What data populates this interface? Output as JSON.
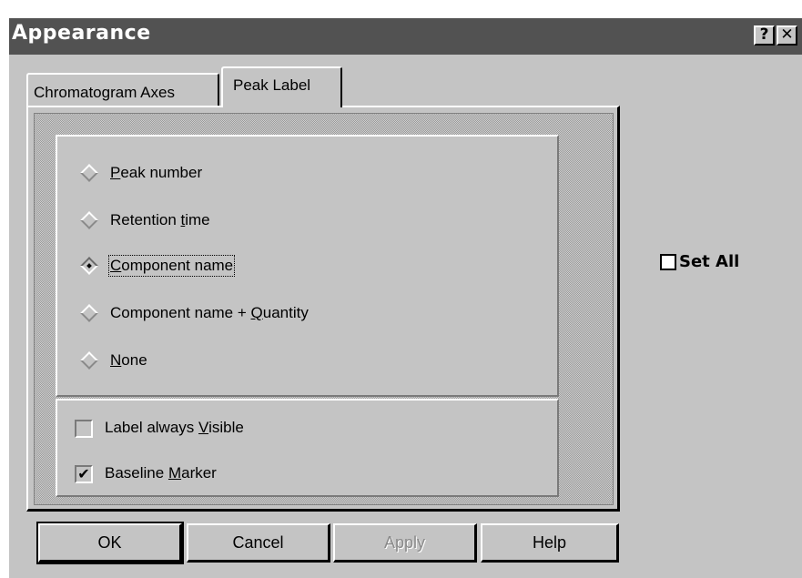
{
  "window": {
    "title": "Appearance",
    "help_button": "?",
    "close_button": "✕"
  },
  "tabs": [
    {
      "label": "Chromatogram Axes",
      "active": false
    },
    {
      "label": "Peak Label",
      "active": true
    }
  ],
  "peak_label_options": {
    "selected": "Component name",
    "items": [
      {
        "pre": "",
        "u": "P",
        "post": "eak number",
        "selected": false
      },
      {
        "pre": "Retention ",
        "u": "t",
        "post": "ime",
        "selected": false
      },
      {
        "pre": "",
        "u": "C",
        "post": "omponent name",
        "selected": true
      },
      {
        "pre": "Component name + ",
        "u": "Q",
        "post": "uantity",
        "selected": false
      },
      {
        "pre": "",
        "u": "N",
        "post": "one",
        "selected": false
      }
    ]
  },
  "checkboxes": [
    {
      "pre": "Label always ",
      "u": "V",
      "post": "isible",
      "checked": false,
      "mark": ""
    },
    {
      "pre": "Baseline ",
      "u": "M",
      "post": "arker",
      "checked": true,
      "mark": "✔"
    }
  ],
  "set_all": {
    "label": "Set All",
    "checked": false
  },
  "buttons": {
    "ok": "OK",
    "cancel": "Cancel",
    "apply": "Apply",
    "help": "Help"
  },
  "colors": {
    "face": "#c4c4c4",
    "titlebar": "#525252",
    "disabled_text": "#8a8a8a"
  }
}
